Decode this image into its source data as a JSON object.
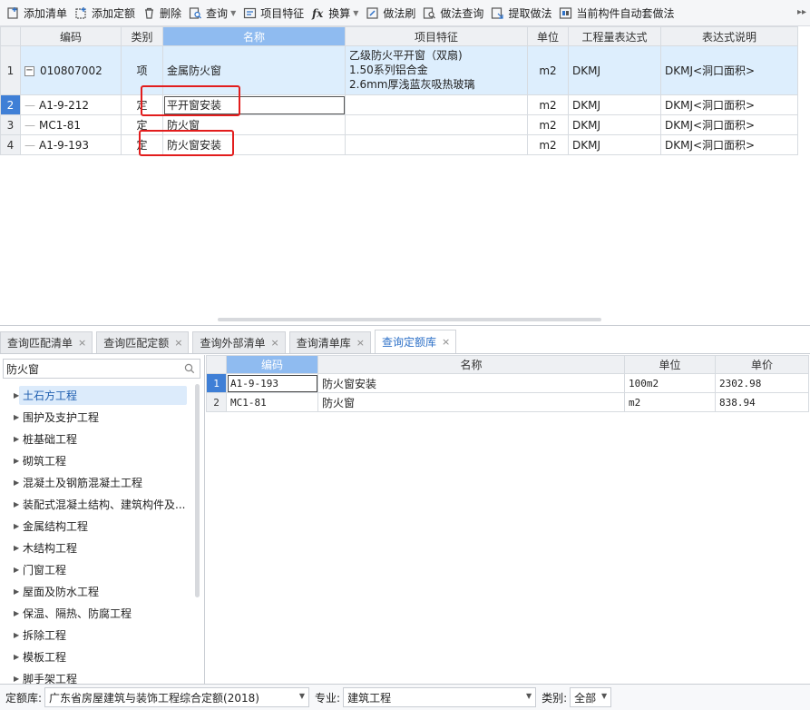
{
  "toolbar": {
    "buttons": [
      {
        "label": "添加清单",
        "icon": "add-list-icon"
      },
      {
        "label": "添加定额",
        "icon": "add-quota-icon"
      },
      {
        "label": "删除",
        "icon": "delete-icon"
      },
      {
        "label": "查询",
        "icon": "query-icon"
      },
      {
        "label": "项目特征",
        "icon": "feature-icon"
      },
      {
        "label": "换算",
        "icon": "fx-icon"
      },
      {
        "label": "做法刷",
        "icon": "brush-icon"
      },
      {
        "label": "做法查询",
        "icon": "method-query-icon"
      },
      {
        "label": "提取做法",
        "icon": "extract-icon"
      },
      {
        "label": "当前构件自动套做法",
        "icon": "auto-apply-icon"
      }
    ]
  },
  "top_grid": {
    "headers": [
      "编码",
      "类别",
      "名称",
      "项目特征",
      "单位",
      "工程量表达式",
      "表达式说明"
    ],
    "rows": [
      {
        "num": "1",
        "code": "010807002",
        "type": "项",
        "name": "金属防火窗",
        "features": [
          "乙级防火平开窗（双扇)",
          "1.50系列铝合金",
          "2.6mm厚浅蓝灰吸热玻璃"
        ],
        "unit": "m2",
        "expr": "DKMJ",
        "desc": "DKMJ<洞口面积>"
      },
      {
        "num": "2",
        "code": "A1-9-212",
        "type": "定",
        "name": "平开窗安装",
        "unit": "m2",
        "expr": "DKMJ",
        "desc": "DKMJ<洞口面积>"
      },
      {
        "num": "3",
        "code": "MC1-81",
        "type": "定",
        "name": "防火窗",
        "unit": "m2",
        "expr": "DKMJ",
        "desc": "DKMJ<洞口面积>"
      },
      {
        "num": "4",
        "code": "A1-9-193",
        "type": "定",
        "name": "防火窗安装",
        "unit": "m2",
        "expr": "DKMJ",
        "desc": "DKMJ<洞口面积>"
      }
    ]
  },
  "tabs": [
    {
      "label": "查询匹配清单",
      "active": false
    },
    {
      "label": "查询匹配定额",
      "active": false
    },
    {
      "label": "查询外部清单",
      "active": false
    },
    {
      "label": "查询清单库",
      "active": false
    },
    {
      "label": "查询定额库",
      "active": true
    }
  ],
  "search": {
    "value": "防火窗"
  },
  "tree": [
    "土石方工程",
    "围护及支护工程",
    "桩基础工程",
    "砌筑工程",
    "混凝土及钢筋混凝土工程",
    "装配式混凝土结构、建筑构件及...",
    "金属结构工程",
    "木结构工程",
    "门窗工程",
    "屋面及防水工程",
    "保温、隔热、防腐工程",
    "拆除工程",
    "模板工程",
    "脚手架工程"
  ],
  "right_grid": {
    "headers": [
      "编码",
      "名称",
      "单位",
      "单价"
    ],
    "rows": [
      {
        "num": "1",
        "code": "A1-9-193",
        "name": "防火窗安装",
        "unit": "100m2",
        "price": "2302.98"
      },
      {
        "num": "2",
        "code": "MC1-81",
        "name": "防火窗",
        "unit": "m2",
        "price": "838.94"
      }
    ]
  },
  "status": {
    "quota_lib_label": "定额库:",
    "quota_lib_value": "广东省房屋建筑与装饰工程综合定额(2018)",
    "major_label": "专业:",
    "major_value": "建筑工程",
    "category_label": "类别:",
    "category_value": "全部"
  },
  "colors": {
    "accent": "#3f7fd6",
    "highlight": "#e21d1d",
    "selected_header": "#8fbbf0"
  }
}
